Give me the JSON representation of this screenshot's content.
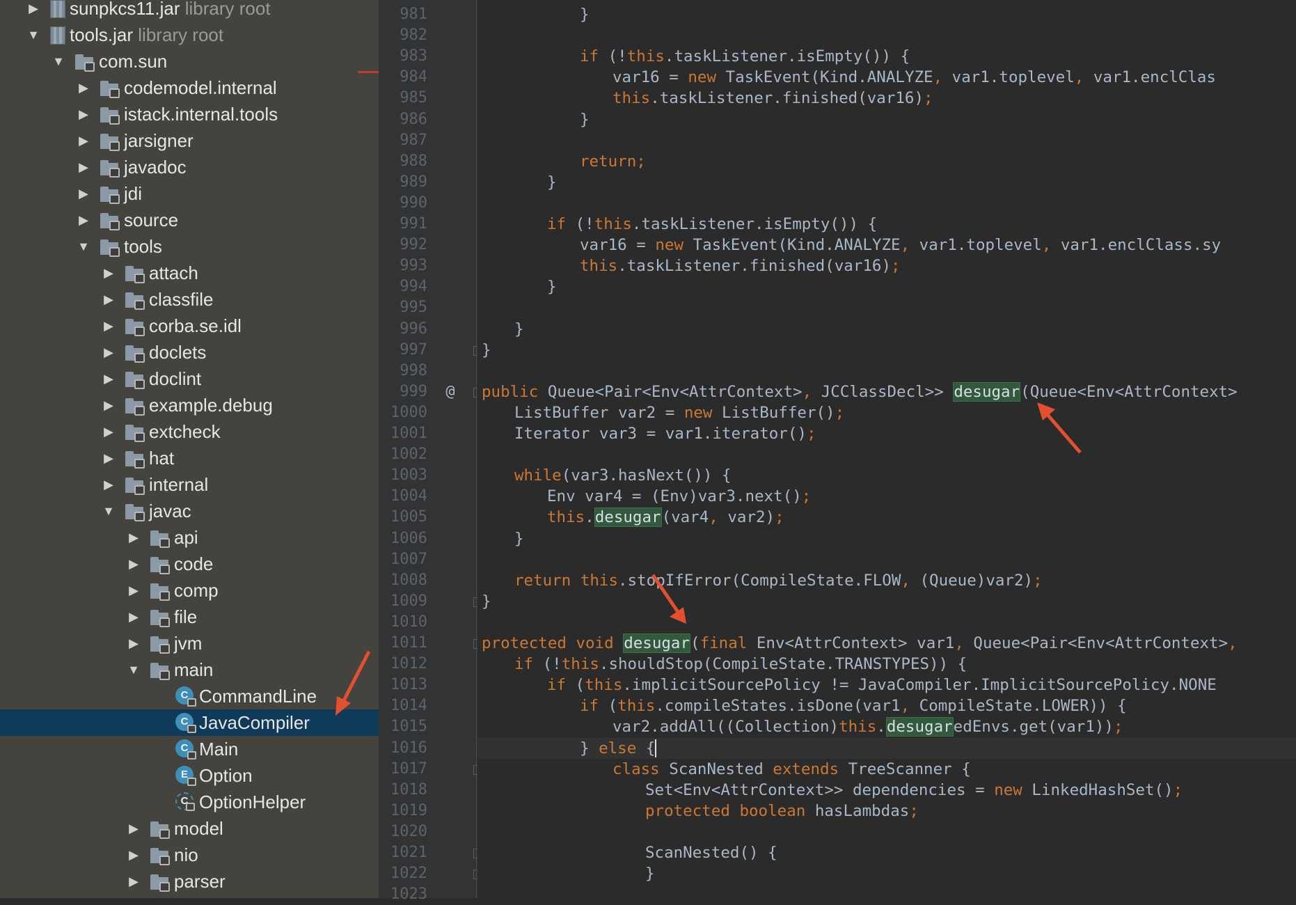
{
  "tree": [
    {
      "id": "sunpkcs11",
      "indent": 1,
      "arrow": "▶",
      "icon": "jar",
      "label": "sunpkcs11.jar",
      "suffix": " library root"
    },
    {
      "id": "tools-jar",
      "indent": 1,
      "arrow": "▼",
      "icon": "jar",
      "label": "tools.jar",
      "suffix": " library root"
    },
    {
      "id": "com-sun",
      "indent": 2,
      "arrow": "▼",
      "icon": "folder",
      "label": "com.sun",
      "suffix": ""
    },
    {
      "id": "codemodel-internal",
      "indent": 3,
      "arrow": "▶",
      "icon": "folder",
      "label": "codemodel.internal",
      "suffix": ""
    },
    {
      "id": "istack-internal-tools",
      "indent": 3,
      "arrow": "▶",
      "icon": "folder",
      "label": "istack.internal.tools",
      "suffix": ""
    },
    {
      "id": "jarsigner",
      "indent": 3,
      "arrow": "▶",
      "icon": "folder",
      "label": "jarsigner",
      "suffix": ""
    },
    {
      "id": "javadoc",
      "indent": 3,
      "arrow": "▶",
      "icon": "folder",
      "label": "javadoc",
      "suffix": ""
    },
    {
      "id": "jdi",
      "indent": 3,
      "arrow": "▶",
      "icon": "folder",
      "label": "jdi",
      "suffix": ""
    },
    {
      "id": "source",
      "indent": 3,
      "arrow": "▶",
      "icon": "folder",
      "label": "source",
      "suffix": ""
    },
    {
      "id": "tools",
      "indent": 3,
      "arrow": "▼",
      "icon": "folder",
      "label": "tools",
      "suffix": ""
    },
    {
      "id": "attach",
      "indent": 4,
      "arrow": "▶",
      "icon": "folder",
      "label": "attach",
      "suffix": ""
    },
    {
      "id": "classfile",
      "indent": 4,
      "arrow": "▶",
      "icon": "folder",
      "label": "classfile",
      "suffix": ""
    },
    {
      "id": "corba-se-idl",
      "indent": 4,
      "arrow": "▶",
      "icon": "folder",
      "label": "corba.se.idl",
      "suffix": ""
    },
    {
      "id": "doclets",
      "indent": 4,
      "arrow": "▶",
      "icon": "folder",
      "label": "doclets",
      "suffix": ""
    },
    {
      "id": "doclint",
      "indent": 4,
      "arrow": "▶",
      "icon": "folder",
      "label": "doclint",
      "suffix": ""
    },
    {
      "id": "example-debug",
      "indent": 4,
      "arrow": "▶",
      "icon": "folder",
      "label": "example.debug",
      "suffix": ""
    },
    {
      "id": "extcheck",
      "indent": 4,
      "arrow": "▶",
      "icon": "folder",
      "label": "extcheck",
      "suffix": ""
    },
    {
      "id": "hat",
      "indent": 4,
      "arrow": "▶",
      "icon": "folder",
      "label": "hat",
      "suffix": ""
    },
    {
      "id": "internal",
      "indent": 4,
      "arrow": "▶",
      "icon": "folder",
      "label": "internal",
      "suffix": ""
    },
    {
      "id": "javac",
      "indent": 4,
      "arrow": "▼",
      "icon": "folder",
      "label": "javac",
      "suffix": ""
    },
    {
      "id": "api",
      "indent": 5,
      "arrow": "▶",
      "icon": "folder",
      "label": "api",
      "suffix": ""
    },
    {
      "id": "code",
      "indent": 5,
      "arrow": "▶",
      "icon": "folder",
      "label": "code",
      "suffix": ""
    },
    {
      "id": "comp",
      "indent": 5,
      "arrow": "▶",
      "icon": "folder",
      "label": "comp",
      "suffix": ""
    },
    {
      "id": "file",
      "indent": 5,
      "arrow": "▶",
      "icon": "folder",
      "label": "file",
      "suffix": ""
    },
    {
      "id": "jvm",
      "indent": 5,
      "arrow": "▶",
      "icon": "folder",
      "label": "jvm",
      "suffix": ""
    },
    {
      "id": "main",
      "indent": 5,
      "arrow": "▼",
      "icon": "folder",
      "label": "main",
      "suffix": ""
    },
    {
      "id": "CommandLine",
      "indent": 6,
      "arrow": "",
      "icon": "class",
      "glyph": "C",
      "label": "CommandLine",
      "suffix": ""
    },
    {
      "id": "JavaCompiler",
      "indent": 6,
      "arrow": "",
      "icon": "class",
      "glyph": "C",
      "label": "JavaCompiler",
      "suffix": "",
      "selected": true
    },
    {
      "id": "Main",
      "indent": 6,
      "arrow": "",
      "icon": "class",
      "glyph": "C",
      "label": "Main",
      "suffix": ""
    },
    {
      "id": "Option",
      "indent": 6,
      "arrow": "",
      "icon": "enum",
      "glyph": "E",
      "label": "Option",
      "suffix": ""
    },
    {
      "id": "OptionHelper",
      "indent": 6,
      "arrow": "",
      "icon": "abstract",
      "glyph": "C",
      "label": "OptionHelper",
      "suffix": ""
    },
    {
      "id": "model",
      "indent": 5,
      "arrow": "▶",
      "icon": "folder",
      "label": "model",
      "suffix": ""
    },
    {
      "id": "nio",
      "indent": 5,
      "arrow": "▶",
      "icon": "folder",
      "label": "nio",
      "suffix": ""
    },
    {
      "id": "parser",
      "indent": 5,
      "arrow": "▶",
      "icon": "folder",
      "label": "parser",
      "suffix": ""
    }
  ],
  "gutter": {
    "line_numbers": [
      "981",
      "982",
      "983",
      "984",
      "985",
      "986",
      "987",
      "988",
      "989",
      "990",
      "991",
      "992",
      "993",
      "994",
      "995",
      "996",
      "997",
      "998",
      "999",
      "1000",
      "1001",
      "1002",
      "1003",
      "1004",
      "1005",
      "1006",
      "1007",
      "1008",
      "1009",
      "1010",
      "1011",
      "1012",
      "1013",
      "1014",
      "1015",
      "1016",
      "1017",
      "1018",
      "1019",
      "1020",
      "1021",
      "1022",
      "1023"
    ],
    "override_marker": {
      "line": "999",
      "glyph": "@"
    },
    "fold_lines": [
      "997",
      "999",
      "1009",
      "1011",
      "1017",
      "1021",
      "1022"
    ]
  },
  "editor": {
    "current_line": "1016",
    "lines": [
      {
        "n": "981",
        "indent": 6,
        "tokens": [
          {
            "t": "}"
          }
        ]
      },
      {
        "n": "982",
        "indent": 0,
        "tokens": []
      },
      {
        "n": "983",
        "indent": 6,
        "tokens": [
          {
            "t": "if",
            "k": "kw"
          },
          {
            "t": " (!"
          },
          {
            "t": "this",
            "k": "kw"
          },
          {
            "t": ".taskListener.isEmpty()) {"
          }
        ]
      },
      {
        "n": "984",
        "indent": 7,
        "tokens": [
          {
            "t": "var16 = "
          },
          {
            "t": "new",
            "k": "kw"
          },
          {
            "t": " TaskEvent(Kind.ANALYZE"
          },
          {
            "t": ",",
            "k": "kw"
          },
          {
            "t": " var1.toplevel"
          },
          {
            "t": ",",
            "k": "kw"
          },
          {
            "t": " var1.enclClas"
          }
        ]
      },
      {
        "n": "985",
        "indent": 7,
        "tokens": [
          {
            "t": "this",
            "k": "kw"
          },
          {
            "t": ".taskListener.finished(var16)"
          },
          {
            "t": ";",
            "k": "kw"
          }
        ]
      },
      {
        "n": "986",
        "indent": 6,
        "tokens": [
          {
            "t": "}"
          }
        ]
      },
      {
        "n": "987",
        "indent": 0,
        "tokens": []
      },
      {
        "n": "988",
        "indent": 6,
        "tokens": [
          {
            "t": "return",
            "k": "kw"
          },
          {
            "t": ";",
            "k": "kw"
          }
        ]
      },
      {
        "n": "989",
        "indent": 5,
        "tokens": [
          {
            "t": "}"
          }
        ]
      },
      {
        "n": "990",
        "indent": 0,
        "tokens": []
      },
      {
        "n": "991",
        "indent": 5,
        "tokens": [
          {
            "t": "if",
            "k": "kw"
          },
          {
            "t": " (!"
          },
          {
            "t": "this",
            "k": "kw"
          },
          {
            "t": ".taskListener.isEmpty()) {"
          }
        ]
      },
      {
        "n": "992",
        "indent": 6,
        "tokens": [
          {
            "t": "var16 = "
          },
          {
            "t": "new",
            "k": "kw"
          },
          {
            "t": " TaskEvent(Kind.ANALYZE"
          },
          {
            "t": ",",
            "k": "kw"
          },
          {
            "t": " var1.toplevel"
          },
          {
            "t": ",",
            "k": "kw"
          },
          {
            "t": " var1.enclClass.sy"
          }
        ]
      },
      {
        "n": "993",
        "indent": 6,
        "tokens": [
          {
            "t": "this",
            "k": "kw"
          },
          {
            "t": ".taskListener.finished(var16)"
          },
          {
            "t": ";",
            "k": "kw"
          }
        ]
      },
      {
        "n": "994",
        "indent": 5,
        "tokens": [
          {
            "t": "}"
          }
        ]
      },
      {
        "n": "995",
        "indent": 0,
        "tokens": []
      },
      {
        "n": "996",
        "indent": 4,
        "tokens": [
          {
            "t": "}"
          }
        ]
      },
      {
        "n": "997",
        "indent": 3,
        "tokens": [
          {
            "t": "}"
          }
        ]
      },
      {
        "n": "998",
        "indent": 0,
        "tokens": []
      },
      {
        "n": "999",
        "indent": 3,
        "tokens": [
          {
            "t": "public",
            "k": "kw"
          },
          {
            "t": " Queue<Pair<Env<AttrContext>"
          },
          {
            "t": ",",
            "k": "kw"
          },
          {
            "t": " JCClassDecl>> "
          },
          {
            "t": "desugar",
            "k": "hl"
          },
          {
            "t": "(Queue<Env<AttrContext>"
          }
        ]
      },
      {
        "n": "1000",
        "indent": 4,
        "tokens": [
          {
            "t": "ListBuffer var2 = "
          },
          {
            "t": "new",
            "k": "kw"
          },
          {
            "t": " ListBuffer()"
          },
          {
            "t": ";",
            "k": "kw"
          }
        ]
      },
      {
        "n": "1001",
        "indent": 4,
        "tokens": [
          {
            "t": "Iterator var3 = var1.iterator()"
          },
          {
            "t": ";",
            "k": "kw"
          }
        ]
      },
      {
        "n": "1002",
        "indent": 0,
        "tokens": []
      },
      {
        "n": "1003",
        "indent": 4,
        "tokens": [
          {
            "t": "while",
            "k": "kw"
          },
          {
            "t": "(var3.hasNext()) {"
          }
        ]
      },
      {
        "n": "1004",
        "indent": 5,
        "tokens": [
          {
            "t": "Env var4 = (Env)var3.next()"
          },
          {
            "t": ";",
            "k": "kw"
          }
        ]
      },
      {
        "n": "1005",
        "indent": 5,
        "tokens": [
          {
            "t": "this",
            "k": "kw"
          },
          {
            "t": "."
          },
          {
            "t": "desugar",
            "k": "hl"
          },
          {
            "t": "(var4"
          },
          {
            "t": ",",
            "k": "kw"
          },
          {
            "t": " var2)"
          },
          {
            "t": ";",
            "k": "kw"
          }
        ]
      },
      {
        "n": "1006",
        "indent": 4,
        "tokens": [
          {
            "t": "}"
          }
        ]
      },
      {
        "n": "1007",
        "indent": 0,
        "tokens": []
      },
      {
        "n": "1008",
        "indent": 4,
        "tokens": [
          {
            "t": "return",
            "k": "kw"
          },
          {
            "t": " "
          },
          {
            "t": "this",
            "k": "kw"
          },
          {
            "t": ".stopIfError(CompileState.FLOW"
          },
          {
            "t": ",",
            "k": "kw"
          },
          {
            "t": " (Queue)var2)"
          },
          {
            "t": ";",
            "k": "kw"
          }
        ]
      },
      {
        "n": "1009",
        "indent": 3,
        "tokens": [
          {
            "t": "}"
          }
        ]
      },
      {
        "n": "1010",
        "indent": 0,
        "tokens": []
      },
      {
        "n": "1011",
        "indent": 3,
        "tokens": [
          {
            "t": "protected",
            "k": "kw"
          },
          {
            "t": " "
          },
          {
            "t": "void",
            "k": "kw"
          },
          {
            "t": " "
          },
          {
            "t": "desugar",
            "k": "hl"
          },
          {
            "t": "("
          },
          {
            "t": "final",
            "k": "kw"
          },
          {
            "t": " Env<AttrContext> var1"
          },
          {
            "t": ",",
            "k": "kw"
          },
          {
            "t": " Queue<Pair<Env<AttrContext>"
          },
          {
            "t": ",",
            "k": "kw"
          }
        ]
      },
      {
        "n": "1012",
        "indent": 4,
        "tokens": [
          {
            "t": "if",
            "k": "kw"
          },
          {
            "t": " (!"
          },
          {
            "t": "this",
            "k": "kw"
          },
          {
            "t": ".shouldStop(CompileState.TRANSTYPES)) {"
          }
        ]
      },
      {
        "n": "1013",
        "indent": 5,
        "tokens": [
          {
            "t": "if",
            "k": "kw"
          },
          {
            "t": " ("
          },
          {
            "t": "this",
            "k": "kw"
          },
          {
            "t": ".implicitSourcePolicy != JavaCompiler.ImplicitSourcePolicy.NONE"
          }
        ]
      },
      {
        "n": "1014",
        "indent": 6,
        "tokens": [
          {
            "t": "if",
            "k": "kw"
          },
          {
            "t": " ("
          },
          {
            "t": "this",
            "k": "kw"
          },
          {
            "t": ".compileStates.isDone(var1"
          },
          {
            "t": ",",
            "k": "kw"
          },
          {
            "t": " CompileState.LOWER)) {"
          }
        ]
      },
      {
        "n": "1015",
        "indent": 7,
        "tokens": [
          {
            "t": "var2.addAll((Collection)"
          },
          {
            "t": "this",
            "k": "kw"
          },
          {
            "t": "."
          },
          {
            "t": "desugar",
            "k": "hl"
          },
          {
            "t": "edEnvs.get(var1))"
          },
          {
            "t": ";",
            "k": "kw"
          }
        ]
      },
      {
        "n": "1016",
        "indent": 6,
        "tokens": [
          {
            "t": "} "
          },
          {
            "t": "else",
            "k": "kw"
          },
          {
            "t": " {"
          },
          {
            "t": "",
            "k": "caret"
          }
        ]
      },
      {
        "n": "1017",
        "indent": 7,
        "tokens": [
          {
            "t": "class",
            "k": "kw"
          },
          {
            "t": " ScanNested "
          },
          {
            "t": "extends",
            "k": "kw"
          },
          {
            "t": " TreeScanner {"
          }
        ]
      },
      {
        "n": "1018",
        "indent": 8,
        "tokens": [
          {
            "t": "Set<Env<AttrContext>> dependencies = "
          },
          {
            "t": "new",
            "k": "kw"
          },
          {
            "t": " LinkedHashSet()"
          },
          {
            "t": ";",
            "k": "kw"
          }
        ]
      },
      {
        "n": "1019",
        "indent": 8,
        "tokens": [
          {
            "t": "protected",
            "k": "kw"
          },
          {
            "t": " "
          },
          {
            "t": "boolean",
            "k": "kw"
          },
          {
            "t": " hasLambdas"
          },
          {
            "t": ";",
            "k": "kw"
          }
        ]
      },
      {
        "n": "1020",
        "indent": 0,
        "tokens": []
      },
      {
        "n": "1021",
        "indent": 8,
        "tokens": [
          {
            "t": "ScanNested() {"
          }
        ]
      },
      {
        "n": "1022",
        "indent": 8,
        "tokens": [
          {
            "t": "}"
          }
        ]
      },
      {
        "n": "1023",
        "indent": 0,
        "tokens": []
      }
    ]
  },
  "colors": {
    "keyword": "#cc7832",
    "identifier": "#a9b7c6",
    "usage_highlight": "#32593d",
    "selection": "#0f3a5a",
    "annotation_arrow": "#e4502f"
  }
}
